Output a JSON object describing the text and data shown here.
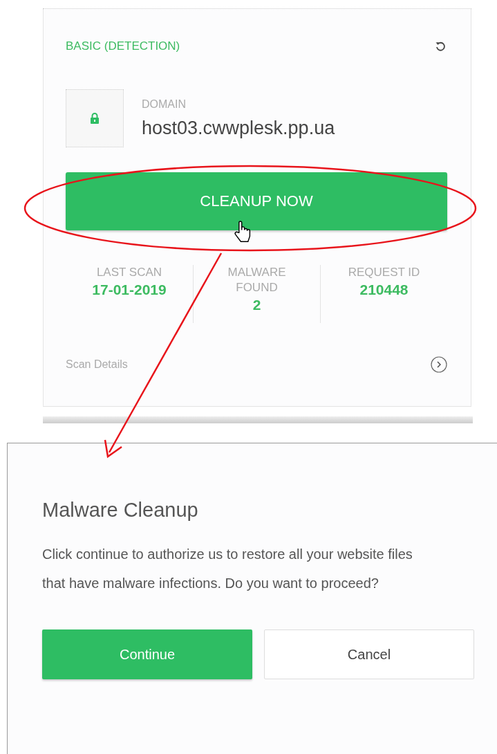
{
  "card": {
    "title": "BASIC (DETECTION)",
    "domain_label": "DOMAIN",
    "domain": "host03.cwwplesk.pp.ua",
    "cleanup_button": "CLEANUP NOW",
    "stats": [
      {
        "label": "LAST SCAN",
        "value": "17-01-2019"
      },
      {
        "label": "MALWARE FOUND",
        "value": "2"
      },
      {
        "label": "REQUEST ID",
        "value": "210448"
      }
    ],
    "scan_details": "Scan Details"
  },
  "dialog": {
    "title": "Malware Cleanup",
    "message": "Click continue to authorize us to restore all your website files that have malware infections. Do you want to proceed?",
    "buttons": [
      {
        "label": "Continue",
        "kind": "primary"
      },
      {
        "label": "Cancel",
        "kind": "secondary"
      }
    ]
  }
}
